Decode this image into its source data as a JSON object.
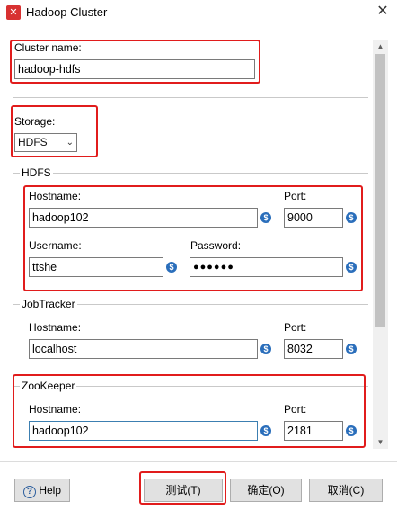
{
  "window": {
    "title": "Hadoop Cluster",
    "close_glyph": "✕",
    "app_icon_glyph": "✕"
  },
  "cluster": {
    "label": "Cluster name:",
    "value": "hadoop-hdfs"
  },
  "storage": {
    "label": "Storage:",
    "value": "HDFS"
  },
  "hdfs": {
    "group_title": "HDFS",
    "hostname_label": "Hostname:",
    "hostname_value": "hadoop102",
    "port_label": "Port:",
    "port_value": "9000",
    "username_label": "Username:",
    "username_value": "ttshe",
    "password_label": "Password:",
    "password_value": "●●●●●●"
  },
  "jobtracker": {
    "group_title": "JobTracker",
    "hostname_label": "Hostname:",
    "hostname_value": "localhost",
    "port_label": "Port:",
    "port_value": "8032"
  },
  "zookeeper": {
    "group_title": "ZooKeeper",
    "hostname_label": "Hostname:",
    "hostname_value": "hadoop102",
    "port_label": "Port:",
    "port_value": "2181"
  },
  "icons": {
    "variable_glyph": "$",
    "help_glyph": "?",
    "dropdown_glyph": "⌄",
    "scroll_up_glyph": "▲",
    "scroll_down_glyph": "▼"
  },
  "buttons": {
    "help": "Help",
    "test": "测试(T)",
    "ok": "确定(O)",
    "cancel": "取消(C)"
  },
  "colors": {
    "highlight_border": "#e11c1c",
    "variable_icon": "#2a6ebb"
  }
}
